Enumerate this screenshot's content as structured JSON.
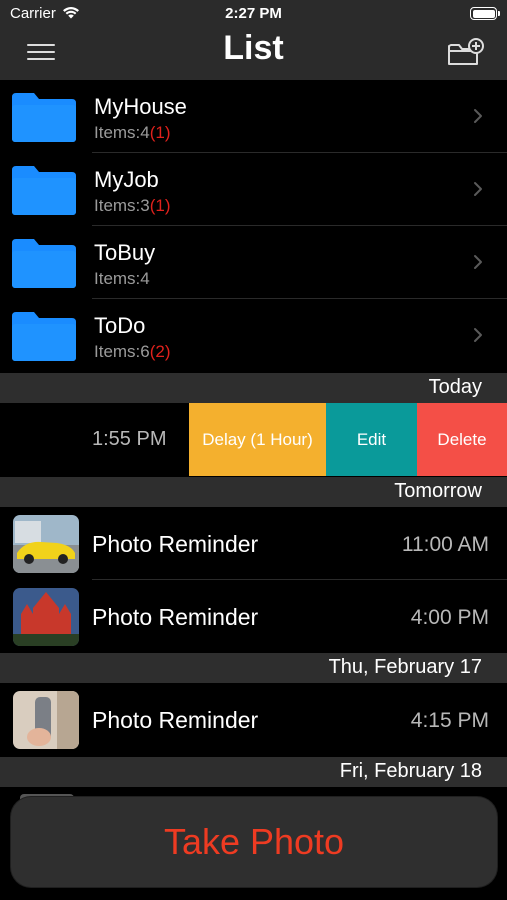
{
  "status_bar": {
    "carrier": "Carrier",
    "time": "2:27 PM"
  },
  "nav": {
    "title": "List",
    "left_icon": "hamburger-menu-icon",
    "right_icon": "new-folder-icon"
  },
  "folders": [
    {
      "name": "MyHouse",
      "count_prefix": "Items:",
      "count": "4",
      "alert": "(1)"
    },
    {
      "name": "MyJob",
      "count_prefix": "Items:",
      "count": "3",
      "alert": "(1)"
    },
    {
      "name": "ToBuy",
      "count_prefix": "Items:",
      "count": "4",
      "alert": ""
    },
    {
      "name": "ToDo",
      "count_prefix": "Items:",
      "count": "6",
      "alert": "(2)"
    }
  ],
  "sections": {
    "today": "Today",
    "tomorrow": "Tomorrow",
    "thu": "Thu, February 17",
    "fri": "Fri, February 18"
  },
  "swipe_row": {
    "time": "1:55 PM",
    "actions": {
      "delay": "Delay (1 Hour)",
      "edit": "Edit",
      "delete": "Delete"
    }
  },
  "reminders": [
    {
      "title": "Photo Reminder",
      "time": "11:00 AM",
      "thumb": "yellow-sports-car"
    },
    {
      "title": "Photo Reminder",
      "time": "4:00 PM",
      "thumb": "red-castle"
    },
    {
      "title": "Photo Reminder",
      "time": "4:15 PM",
      "thumb": "handheld-bottle"
    }
  ],
  "take_photo": "Take Photo",
  "colors": {
    "folder_blue": "#1a8cff",
    "alert_red": "#e0211c",
    "delay_yellow": "#f4b02e",
    "edit_teal": "#0a9a9a",
    "delete_red": "#f44f47",
    "take_photo_text": "#ee3b22"
  }
}
